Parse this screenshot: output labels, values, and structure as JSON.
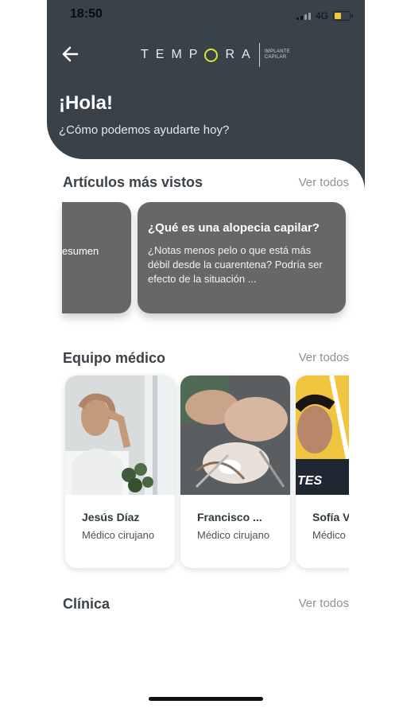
{
  "status": {
    "time": "18:50",
    "network": "4G"
  },
  "brand": {
    "name_left": "TEMP",
    "name_right": "RA",
    "sub_line1": "IMPLANTE",
    "sub_line2": "CAPILAR"
  },
  "greeting": {
    "title": "¡Hola!",
    "subtitle": "¿Cómo podemos ayudarte hoy?"
  },
  "articles": {
    "section_title": "Artículos más vistos",
    "see_all": "Ver todos",
    "items": [
      {
        "fragment": "esumen"
      },
      {
        "title": "¿Qué es una alopecia capilar?",
        "desc": "¿Notas menos pelo o que está más débil desde la cuarentena? Podría ser efecto de la situación ..."
      }
    ]
  },
  "team": {
    "section_title": "Equipo médico",
    "see_all": "Ver todos",
    "doctors": [
      {
        "name": "Jesús Díaz",
        "role": "Médico cirujano"
      },
      {
        "name": "Francisco ...",
        "role": "Médico cirujano"
      },
      {
        "name": "Sofía V",
        "role": "Médico",
        "photo_text": "TES"
      }
    ]
  },
  "clinic": {
    "section_title": "Clínica",
    "see_all": "Ver todos"
  },
  "colors": {
    "header": "#3a4249",
    "accent": "#d6e23a",
    "card": "#666769"
  }
}
